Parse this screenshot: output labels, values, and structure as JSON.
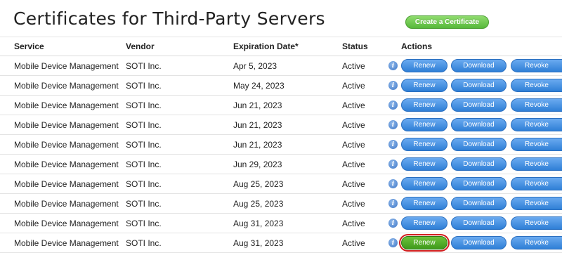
{
  "page": {
    "title": "Certificates for Third-Party Servers",
    "create_button": "Create a Certificate"
  },
  "table": {
    "headers": {
      "service": "Service",
      "vendor": "Vendor",
      "expiration": "Expiration Date*",
      "status": "Status",
      "actions": "Actions"
    },
    "info_glyph": "i",
    "buttons": {
      "renew": "Renew",
      "download": "Download",
      "revoke": "Revoke"
    },
    "rows": [
      {
        "service": "Mobile Device Management",
        "vendor": "SOTI Inc.",
        "expiration": "Apr 5, 2023",
        "status": "Active"
      },
      {
        "service": "Mobile Device Management",
        "vendor": "SOTI Inc.",
        "expiration": "May 24, 2023",
        "status": "Active"
      },
      {
        "service": "Mobile Device Management",
        "vendor": "SOTI Inc.",
        "expiration": "Jun 21, 2023",
        "status": "Active"
      },
      {
        "service": "Mobile Device Management",
        "vendor": "SOTI Inc.",
        "expiration": "Jun 21, 2023",
        "status": "Active"
      },
      {
        "service": "Mobile Device Management",
        "vendor": "SOTI Inc.",
        "expiration": "Jun 21, 2023",
        "status": "Active"
      },
      {
        "service": "Mobile Device Management",
        "vendor": "SOTI Inc.",
        "expiration": "Jun 29, 2023",
        "status": "Active"
      },
      {
        "service": "Mobile Device Management",
        "vendor": "SOTI Inc.",
        "expiration": "Aug 25, 2023",
        "status": "Active"
      },
      {
        "service": "Mobile Device Management",
        "vendor": "SOTI Inc.",
        "expiration": "Aug 25, 2023",
        "status": "Active"
      },
      {
        "service": "Mobile Device Management",
        "vendor": "SOTI Inc.",
        "expiration": "Aug 31, 2023",
        "status": "Active"
      },
      {
        "service": "Mobile Device Management",
        "vendor": "SOTI Inc.",
        "expiration": "Aug 31, 2023",
        "status": "Active",
        "renew_highlighted": true
      }
    ]
  },
  "icons": {
    "info": "info-icon"
  },
  "colors": {
    "action_button": "#2f7fd6",
    "create_button": "#57b83a",
    "highlighted_renew": "#3f9a1c",
    "highlight_outline": "#d21f1f"
  }
}
